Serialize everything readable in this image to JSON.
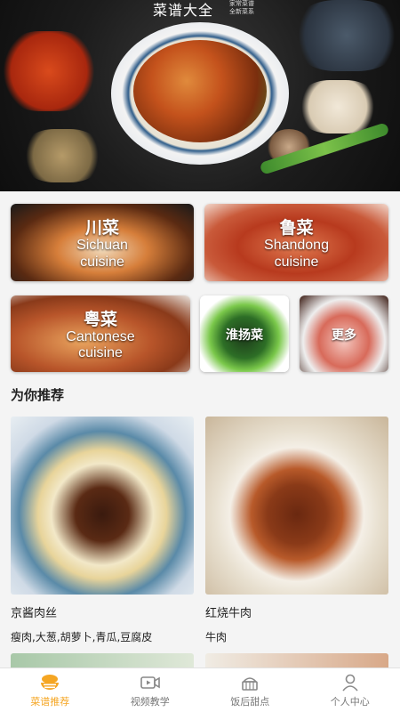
{
  "banner": {
    "title": "菜谱大全",
    "subtitle_line1": "家常菜谱",
    "subtitle_line2": "全新菜系"
  },
  "categories": [
    {
      "id": "sichuan",
      "cn": "川菜",
      "en_line1": "Sichuan",
      "en_line2": "cuisine"
    },
    {
      "id": "shandong",
      "cn": "鲁菜",
      "en_line1": "Shandong",
      "en_line2": "cuisine"
    },
    {
      "id": "cantonese",
      "cn": "粤菜",
      "en_line1": "Cantonese",
      "en_line2": "cuisine"
    },
    {
      "id": "huaiyang",
      "cn": "淮扬菜"
    },
    {
      "id": "more",
      "cn": "更多"
    }
  ],
  "recommend": {
    "title": "为你推荐",
    "items": [
      {
        "name": "京酱肉丝",
        "ingredients": "瘦肉,大葱,胡萝卜,青瓜,豆腐皮"
      },
      {
        "name": "红烧牛肉",
        "ingredients": "牛肉"
      }
    ]
  },
  "tabbar": {
    "active_color": "#f5a623",
    "inactive_color": "#777777",
    "tabs": [
      {
        "label": "菜谱推荐",
        "icon": "bowl-icon",
        "active": true
      },
      {
        "label": "视频教学",
        "icon": "video-icon",
        "active": false
      },
      {
        "label": "饭后甜点",
        "icon": "cake-icon",
        "active": false
      },
      {
        "label": "个人中心",
        "icon": "person-icon",
        "active": false
      }
    ]
  }
}
